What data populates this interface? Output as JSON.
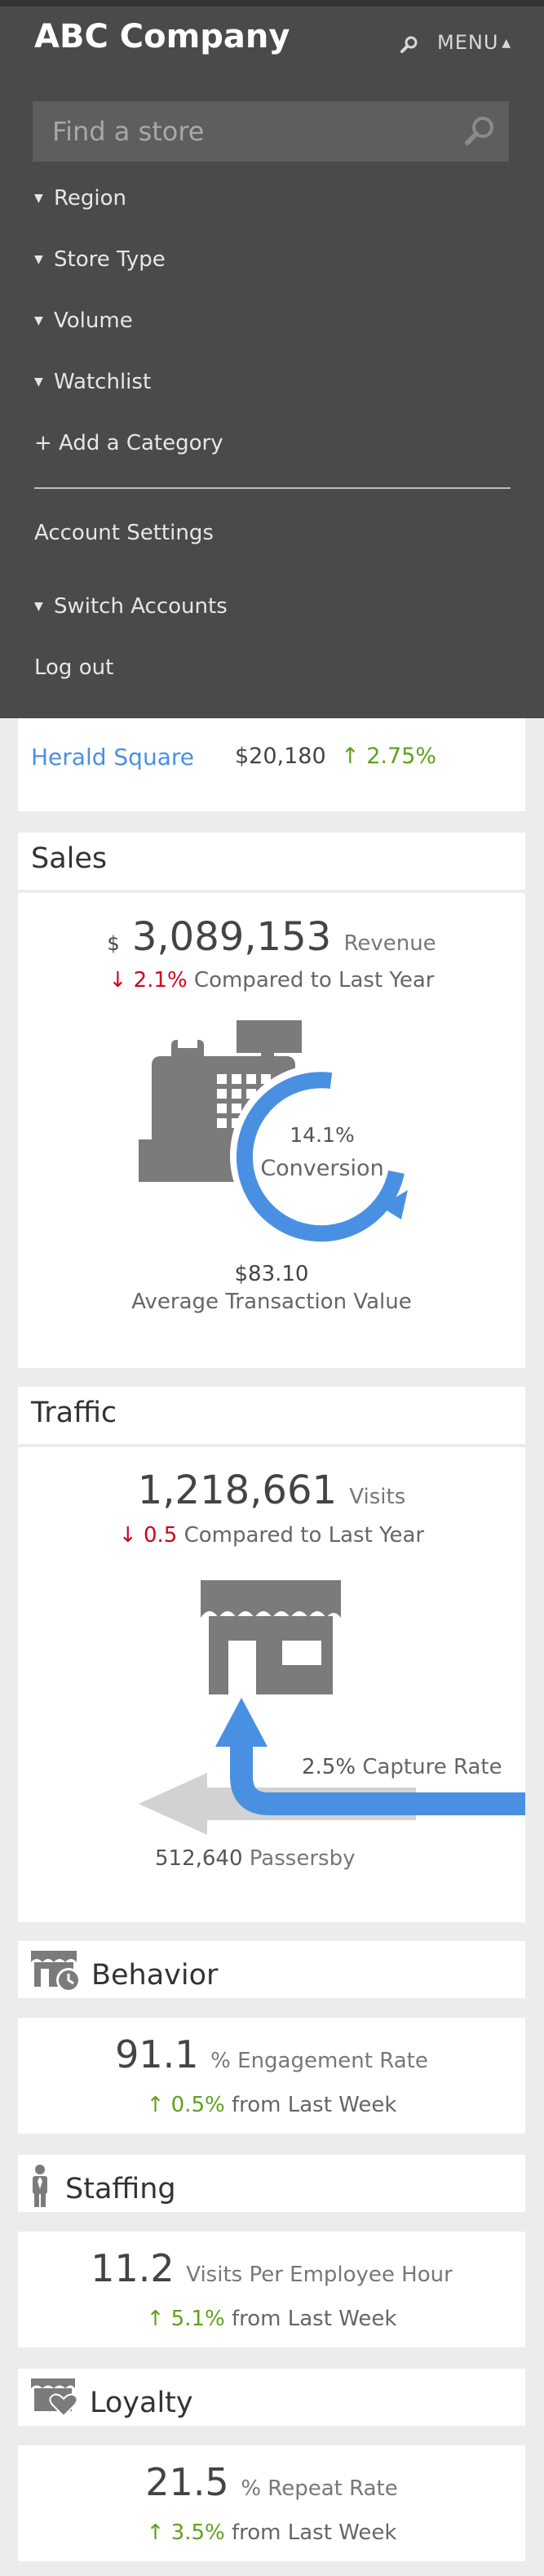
{
  "header": {
    "brand": "ABC Company",
    "menu_label": "MENU",
    "search_placeholder": "Find a store"
  },
  "menu": {
    "items": [
      "Region",
      "Store Type",
      "Volume",
      "Watchlist"
    ],
    "add_category": "+ Add a Category",
    "account_settings": "Account Settings",
    "switch_accounts": "Switch Accounts",
    "logout": "Log out"
  },
  "stores": {
    "row": {
      "name": "Herald Square",
      "value": "$20,180",
      "change": "2.75%"
    }
  },
  "sales": {
    "title": "Sales",
    "currency": "$",
    "revenue": "3,089,153",
    "revenue_label": "Revenue",
    "change": "2.1%",
    "change_label": "Compared to Last Year",
    "conversion_value": "14.1%",
    "conversion_label": "Conversion",
    "atv_value": "$83.10",
    "atv_label": "Average Transaction Value"
  },
  "traffic": {
    "title": "Traffic",
    "visits": "1,218,661",
    "visits_label": "Visits",
    "change": "0.5",
    "change_label": "Compared to Last Year",
    "capture_value": "2.5%",
    "capture_label": "Capture Rate",
    "passersby_value": "512,640",
    "passersby_label": "Passersby"
  },
  "behavior": {
    "title": "Behavior",
    "value": "91.1",
    "label": "% Engagement Rate",
    "change": "0.5%",
    "change_label": "from Last Week"
  },
  "staffing": {
    "title": "Staffing",
    "value": "11.2",
    "label": "Visits Per Employee Hour",
    "change": "5.1%",
    "change_label": "from Last Week"
  },
  "loyalty": {
    "title": "Loyalty",
    "value": "21.5",
    "label": "% Repeat Rate",
    "change": "3.5%",
    "change_label": "from Last Week"
  },
  "colors": {
    "accent_blue": "#4a90e2",
    "down_red": "#d0021b",
    "up_green": "#5fa11a",
    "menu_bg": "#4a4a4a"
  },
  "icons": [
    "search-icon",
    "cash-register-icon",
    "storefront-icon",
    "behavior-icon",
    "staff-person-icon",
    "loyalty-heart-icon"
  ]
}
